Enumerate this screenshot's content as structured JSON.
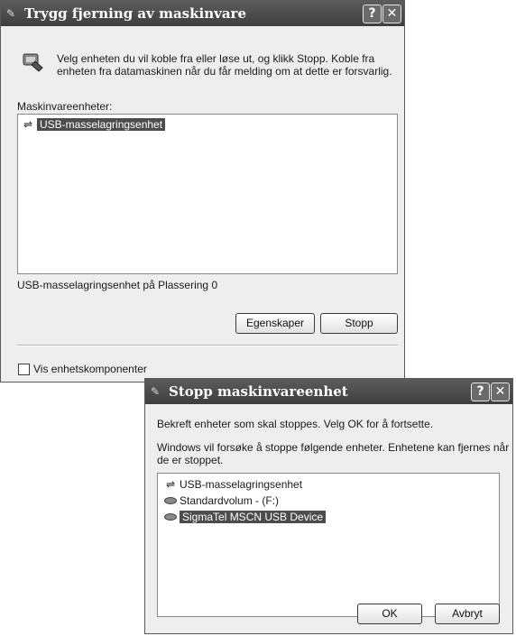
{
  "safe_removal": {
    "title": "Trygg fjerning av maskinvare",
    "help_button": "?",
    "close_button": "✕",
    "instruction_line1": "Velg enheten du vil koble fra eller løse ut, og klikk Stopp. Koble fra",
    "instruction_line2": "enheten fra datamaskinen når du får melding om at dette er forsvarlig.",
    "devices_label": "Maskinvareenheter:",
    "devices": [
      {
        "label": "USB-masselagringsenhet",
        "icon": "usb-icon",
        "selected": true
      }
    ],
    "status_text": "USB-masselagringsenhet på Plassering 0",
    "properties_button": "Egenskaper",
    "stop_button": "Stopp",
    "show_components_label": "Vis enhetskomponenter"
  },
  "stop_dialog": {
    "title": "Stopp maskinvareenhet",
    "help_button": "?",
    "close_button": "✕",
    "confirm_text": "Bekreft enheter som skal stoppes. Velg OK for å fortsette.",
    "info_line1": "Windows vil forsøke å stoppe følgende enheter. Enhetene kan fjernes når",
    "info_line2": "de er stoppet.",
    "devices": [
      {
        "label": "USB-masselagringsenhet",
        "icon": "usb-icon",
        "selected": false
      },
      {
        "label": "Standardvolum - (F:)",
        "icon": "drive-icon",
        "selected": false
      },
      {
        "label": "SigmaTel MSCN USB Device",
        "icon": "drive-icon",
        "selected": true
      }
    ],
    "ok_button": "OK",
    "cancel_button": "Avbryt"
  },
  "colors": {
    "titlebar": "#4a4a4a",
    "selection": "#4c4c4c",
    "dialog_bg": "#eeeeee"
  }
}
